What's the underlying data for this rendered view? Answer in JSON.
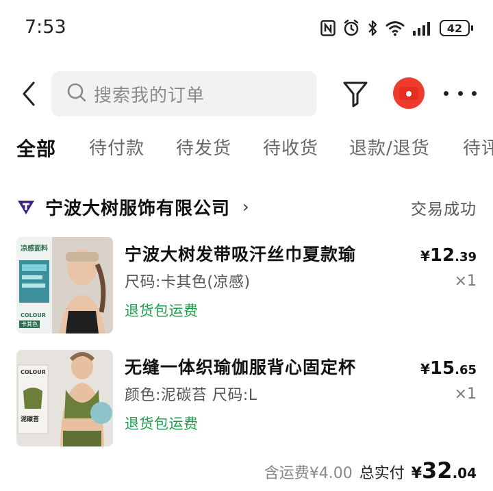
{
  "status_bar": {
    "time": "7:53",
    "battery": "42",
    "icons": [
      "nfc-icon",
      "alarm-icon",
      "bluetooth-icon",
      "wifi-icon",
      "signal-icon",
      "battery-icon"
    ]
  },
  "search": {
    "placeholder": "搜索我的订单"
  },
  "tabs": [
    {
      "label": "全部",
      "active": true
    },
    {
      "label": "待付款",
      "active": false
    },
    {
      "label": "待发货",
      "active": false
    },
    {
      "label": "待收货",
      "active": false
    },
    {
      "label": "退款/退货",
      "active": false
    },
    {
      "label": "待评",
      "active": false
    }
  ],
  "order": {
    "shop_name": "宁波大树服饰有限公司",
    "shop_chevron": "›",
    "status": "交易成功",
    "items": [
      {
        "title": "宁波大树发带吸汗丝巾夏款瑜",
        "spec": "尺码:卡其色(凉感)",
        "badge": "退货包运费",
        "price_symbol": "¥",
        "price_int": "12",
        "price_dec": ".39",
        "qty": "×1",
        "thumb_label_top": "凉感面料",
        "thumb_label_bottom": "COLOUR",
        "thumb_color_name": "卡其色"
      },
      {
        "title": "无缝一体织瑜伽服背心固定杯",
        "spec": "颜色:泥碳苔 尺码:L",
        "badge": "退货包运费",
        "price_symbol": "¥",
        "price_int": "15",
        "price_dec": ".65",
        "qty": "×1",
        "thumb_label_top": "COLOUR",
        "thumb_color_name": "泥碳苔"
      }
    ],
    "shipping_note": "含运费¥4.00",
    "total_label": "总实付",
    "total_symbol": "¥",
    "total_int": "32",
    "total_dec": ".04"
  },
  "colors": {
    "accent_green": "#1e9e4e",
    "red_button": "#ef3b2e",
    "search_bg": "#f2f2f2"
  }
}
